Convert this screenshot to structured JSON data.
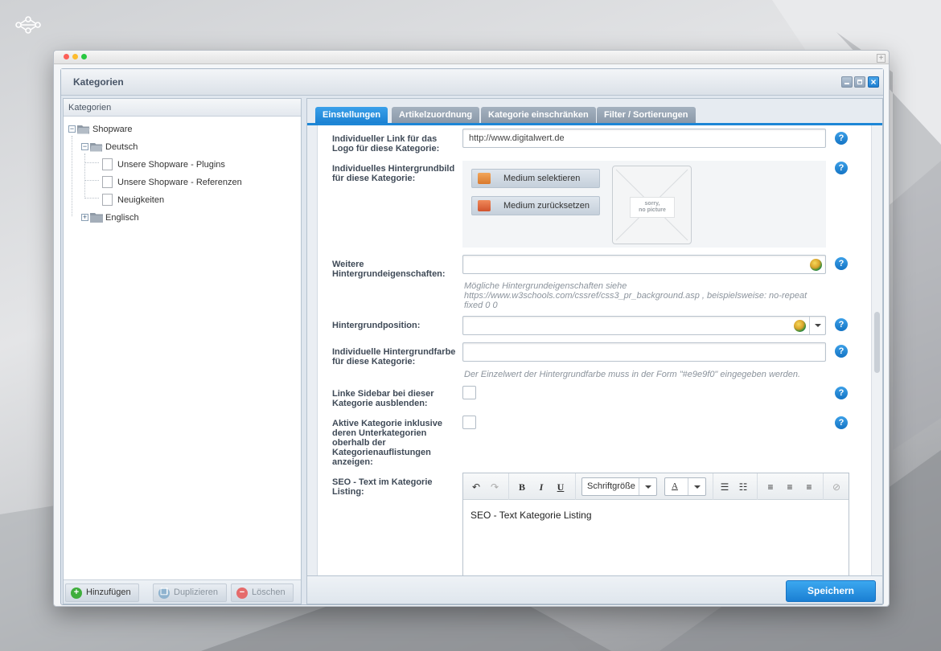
{
  "window": {
    "title": "Kategorien"
  },
  "tree": {
    "header": "Kategorien",
    "nodes": {
      "root": "Shopware",
      "deutsch": "Deutsch",
      "plugins": "Unsere Shopware - Plugins",
      "referenzen": "Unsere Shopware - Referenzen",
      "neuigkeiten": "Neuigkeiten",
      "englisch": "Englisch"
    },
    "toolbar": {
      "add": "Hinzufügen",
      "duplicate": "Duplizieren",
      "delete": "Löschen"
    }
  },
  "tabs": {
    "settings": "Einstellungen",
    "articles": "Artikelzuordnung",
    "restrict": "Kategorie einschränken",
    "filter": "Filter / Sortierungen"
  },
  "form": {
    "logo_link": {
      "label": "Individueller Link für das Logo für diese Kategorie:",
      "value": "http://www.digitalwert.de"
    },
    "bg_image": {
      "label": "Individuelles Hintergrundbild für diese Kategorie:",
      "select_button": "Medium selektieren",
      "reset_button": "Medium zurücksetzen",
      "no_picture_line1": "sorry,",
      "no_picture_line2": "no picture"
    },
    "bg_props": {
      "label": "Weitere Hintergrundeigenschaften:",
      "value": "",
      "hint": "Mögliche Hintergrundeigenschaften siehe https://www.w3schools.com/cssref/css3_pr_background.asp , beispielsweise: no-repeat fixed 0 0"
    },
    "bg_position": {
      "label": "Hintergrundposition:",
      "value": ""
    },
    "bg_color": {
      "label": "Individuelle Hintergrundfarbe für diese Kategorie:",
      "value": "",
      "hint": "Der Einzelwert der Hintergrundfarbe muss in der Form \"#e9e9f0\" eingegeben werden."
    },
    "hide_sidebar": {
      "label": "Linke Sidebar bei dieser Kategorie ausblenden:",
      "checked": false
    },
    "active_category": {
      "label": "Aktive Kategorie inklusive deren Unterkategorien oberhalb der Kategorienauflistungen anzeigen:",
      "checked": false
    },
    "seo_text": {
      "label": "SEO - Text im Kategorie Listing:",
      "font_size_select": "Schriftgröße",
      "bold": "B",
      "italic": "I",
      "underline": "U",
      "font_color": "A",
      "content": "SEO - Text Kategorie Listing"
    }
  },
  "buttons": {
    "save": "Speichern"
  },
  "help_symbol": "?",
  "colors": {
    "accent": "#1d86d6",
    "add_icon": "#3fae3c",
    "delete_icon": "#e56b6b"
  }
}
